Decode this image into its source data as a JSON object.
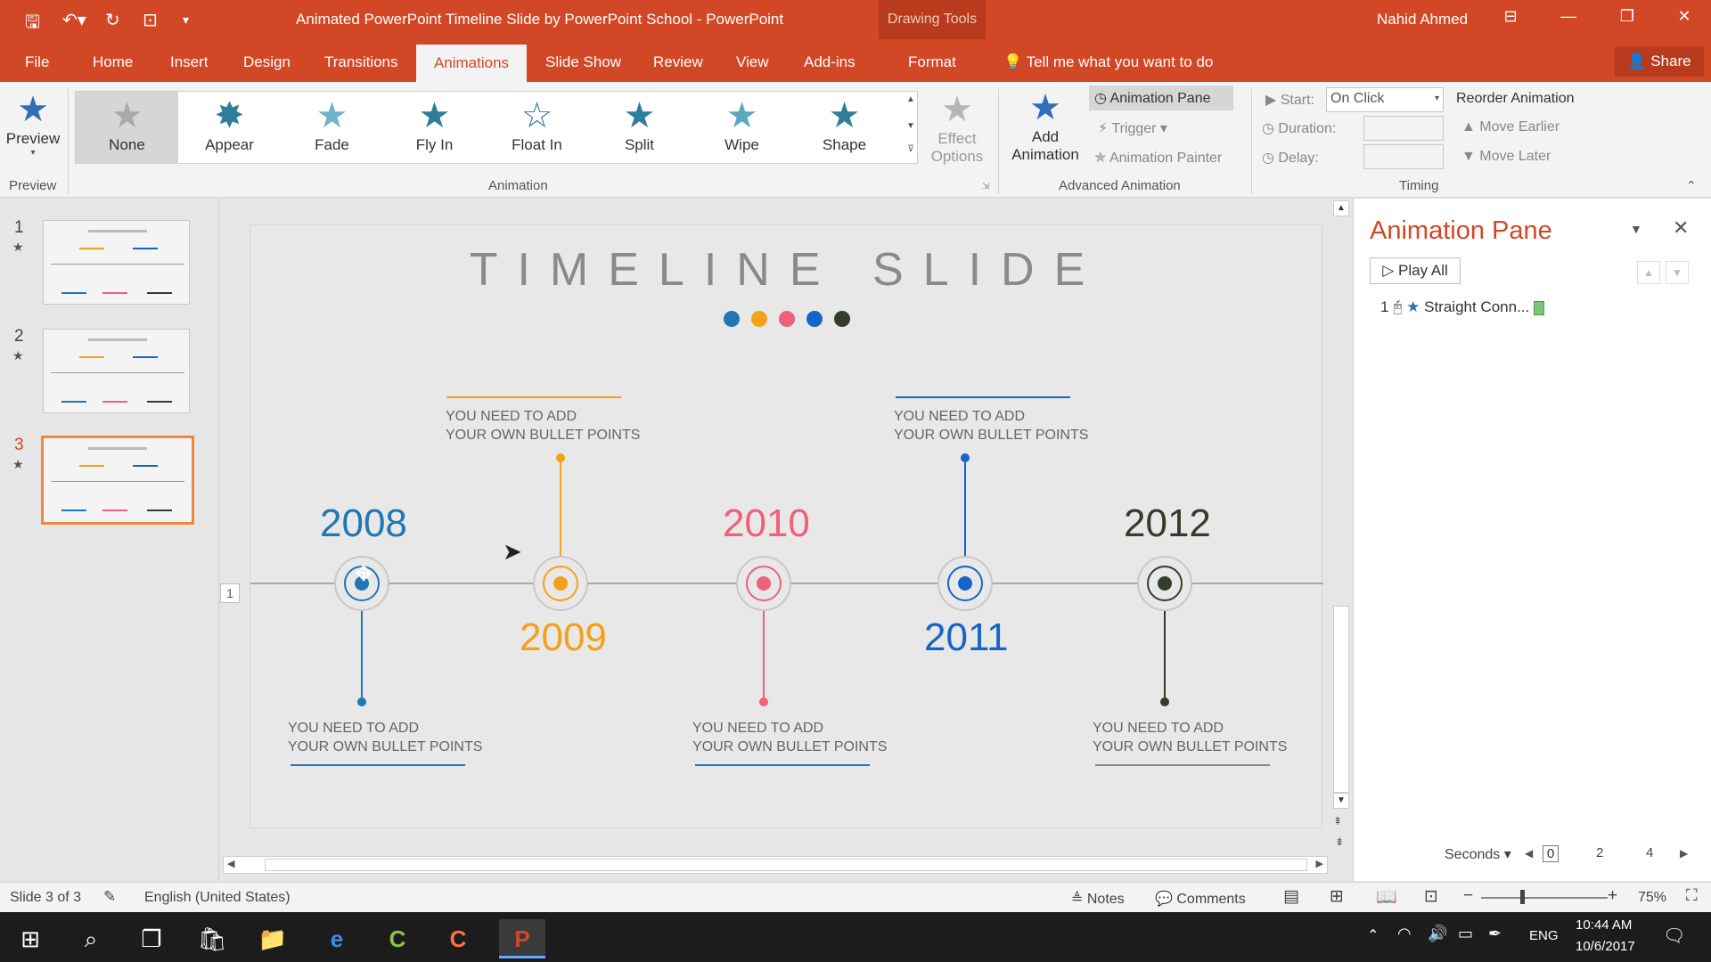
{
  "window": {
    "title": "Animated PowerPoint Timeline Slide by PowerPoint School  -  PowerPoint",
    "contextual_tab_group": "Drawing Tools",
    "user": "Nahid Ahmed"
  },
  "tabs": [
    "File",
    "Home",
    "Insert",
    "Design",
    "Transitions",
    "Animations",
    "Slide Show",
    "Review",
    "View",
    "Add-ins",
    "Format"
  ],
  "active_tab": "Animations",
  "tell_me": "Tell me what you want to do",
  "share": "Share",
  "ribbon": {
    "preview": {
      "label": "Preview",
      "group": "Preview"
    },
    "animation_group": "Animation",
    "animations": [
      "None",
      "Appear",
      "Fade",
      "Fly In",
      "Float In",
      "Split",
      "Wipe",
      "Shape"
    ],
    "selected_animation": "None",
    "effect_options": [
      "Effect",
      "Options"
    ],
    "add_animation": [
      "Add",
      "Animation"
    ],
    "animation_pane_btn": "Animation Pane",
    "trigger": "Trigger",
    "animation_painter": "Animation Painter",
    "advanced_group": "Advanced Animation",
    "start_label": "Start:",
    "start_value": "On Click",
    "duration_label": "Duration:",
    "delay_label": "Delay:",
    "timing_group": "Timing",
    "reorder_title": "Reorder Animation",
    "move_earlier": "Move Earlier",
    "move_later": "Move Later"
  },
  "thumbnails": [
    {
      "num": "1"
    },
    {
      "num": "2"
    },
    {
      "num": "3"
    }
  ],
  "slide": {
    "title": "TIMELINE SLIDE",
    "number_tag": "1",
    "colors": {
      "blue_dark": "#1f77b4",
      "orange": "#f5a019",
      "pink": "#ef6079",
      "blue": "#1565c8",
      "dark": "#333d29"
    },
    "years": [
      "2008",
      "2009",
      "2010",
      "2011",
      "2012"
    ],
    "bullet_line1": "YOU NEED TO ADD",
    "bullet_line2": "YOUR OWN BULLET POINTS"
  },
  "animation_pane": {
    "title": "Animation Pane",
    "play_all": "Play All",
    "item_index": "1",
    "item_name": "Straight Conn...",
    "time_unit": "Seconds",
    "ticks": [
      "0",
      "2",
      "4"
    ]
  },
  "status": {
    "slide_info": "Slide 3 of 3",
    "language": "English (United States)",
    "notes": "Notes",
    "comments": "Comments",
    "zoom": "75%"
  },
  "taskbar": {
    "lang": "ENG",
    "time": "10:44 AM",
    "date": "10/6/2017"
  }
}
